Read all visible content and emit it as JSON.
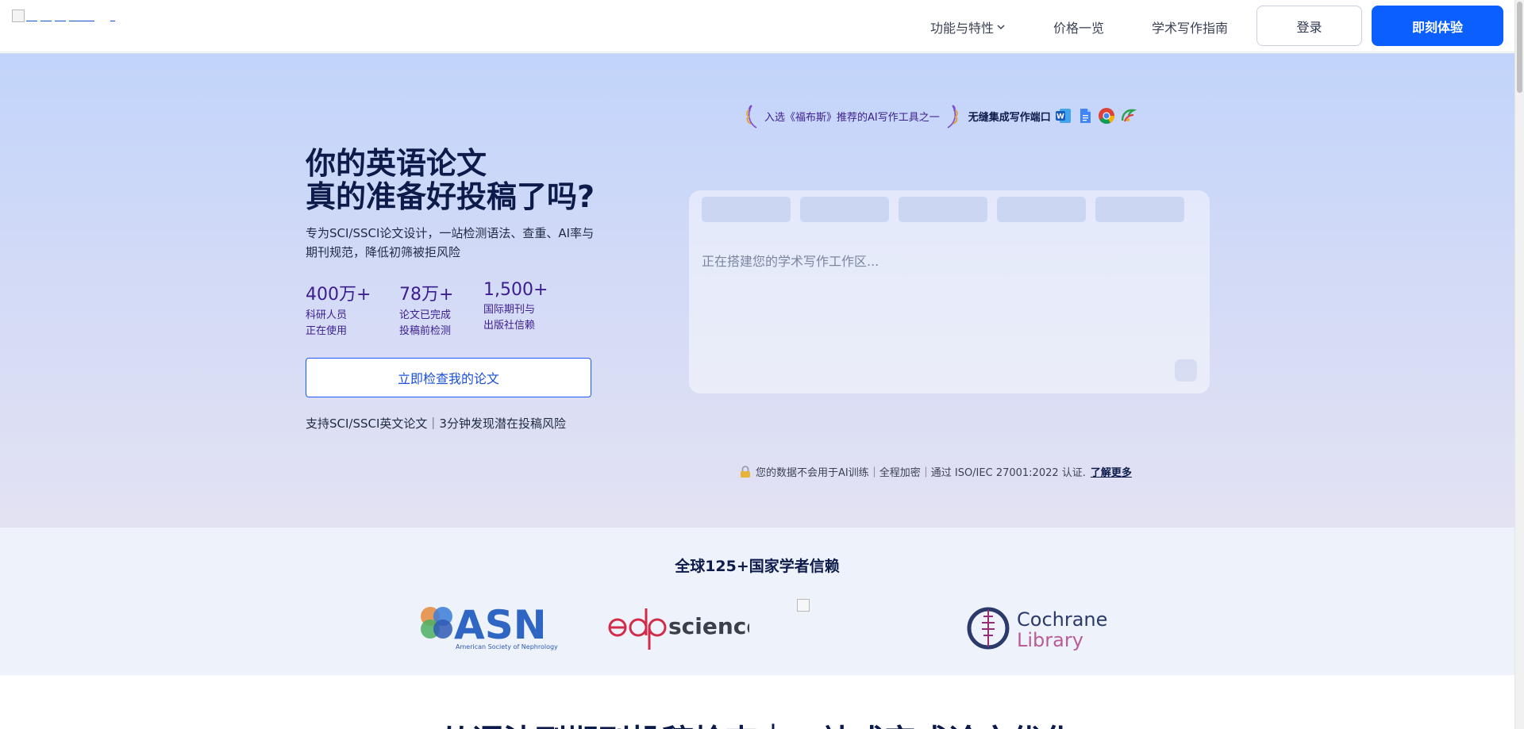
{
  "header": {
    "nav": [
      {
        "label": "功能与特性",
        "has_dropdown": true
      },
      {
        "label": "价格一览"
      },
      {
        "label": "学术写作指南"
      }
    ],
    "login_label": "登录",
    "try_label": "即刻体验"
  },
  "hero": {
    "title_line1": "你的英语论文",
    "title_line2": "真的准备好投稿了吗?",
    "subtitle": "专为SCI/SSCI论文设计，一站检测语法、查重、AI率与期刊规范，降低初筛被拒风险",
    "stats": [
      {
        "number": "400万+",
        "label_line1": "科研人员",
        "label_line2": "正在使用"
      },
      {
        "number": "78万+",
        "label_line1": "论文已完成",
        "label_line2": "投稿前检测"
      },
      {
        "number": "1,500+",
        "label_line1": "国际期刊与",
        "label_line2": "出版社信赖"
      }
    ],
    "cta_label": "立即检查我的论文",
    "support_text": "支持SCI/SSCI英文论文｜3分钟发现潜在投稿风险",
    "award_text": "入选《福布斯》推荐的AI写作工具之一",
    "integration_text": "无缝集成写作端口",
    "integration_apps": [
      "word-icon",
      "google-docs-icon",
      "chrome-icon",
      "wps-icon"
    ],
    "workspace_loading": "正在搭建您的学术写作工作区...",
    "privacy_text": "您的数据不会用于AI训练｜全程加密｜通过 ISO/IEC 27001:2022 认证.",
    "privacy_link": "了解更多"
  },
  "trust": {
    "title": "全球125+国家学者信赖",
    "logos": [
      {
        "name": "ASN",
        "sub": "American Society of Nephrology"
      },
      {
        "name": "sciences"
      },
      {
        "name": "Cochrane",
        "sub": "Library"
      }
    ]
  },
  "next_section": {
    "title": "从语法到期刊投稿检查｜一站式完成论文优化"
  },
  "colors": {
    "primary": "#0b5fff",
    "heading": "#0d1b4b",
    "stat": "#3c1d8f"
  }
}
